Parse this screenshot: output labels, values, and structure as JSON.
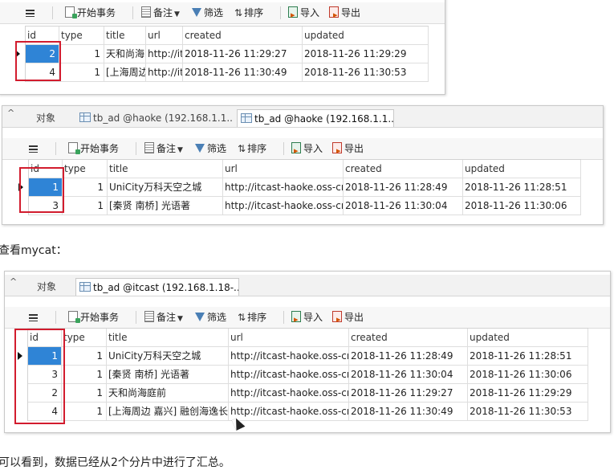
{
  "toolbar": {
    "start_transaction": "开始事务",
    "memo": "备注",
    "filter": "筛选",
    "sort": "排序",
    "import": "导入",
    "export": "导出"
  },
  "columns": [
    "id",
    "type",
    "title",
    "url",
    "created",
    "updated"
  ],
  "panel1": {
    "rows": [
      {
        "id": "2",
        "type": "1",
        "title": "天和尚海",
        "url": "http://it",
        "created": "2018-11-26 11:29:27",
        "updated": "2018-11-26 11:29:29"
      },
      {
        "id": "4",
        "type": "1",
        "title": "[上海周边",
        "url": "http://it",
        "created": "2018-11-26 11:30:49",
        "updated": "2018-11-26 11:30:53"
      }
    ]
  },
  "panel2": {
    "tab_objects": "对象",
    "tab_1": "tb_ad @haoke (192.168.1.1...",
    "tab_2": "tb_ad @haoke (192.168.1.1...",
    "rows": [
      {
        "id": "1",
        "type": "1",
        "title": "UniCity万科天空之城",
        "url": "http://itcast-haoke.oss-cn",
        "created": "2018-11-26 11:28:49",
        "updated": "2018-11-26 11:28:51"
      },
      {
        "id": "3",
        "type": "1",
        "title": "[秦贤 南桥] 光语著",
        "url": "http://itcast-haoke.oss-cn",
        "created": "2018-11-26 11:30:04",
        "updated": "2018-11-26 11:30:06"
      }
    ]
  },
  "mid_text": "查看mycat：",
  "panel3": {
    "tab_objects": "对象",
    "tab_1": "tb_ad @itcast (192.168.1.18-...",
    "rows": [
      {
        "id": "1",
        "type": "1",
        "title": "UniCity万科天空之城",
        "url": "http://itcast-haoke.oss-cn",
        "created": "2018-11-26 11:28:49",
        "updated": "2018-11-26 11:28:51"
      },
      {
        "id": "3",
        "type": "1",
        "title": "[秦贤 南桥] 光语著",
        "url": "http://itcast-haoke.oss-cn",
        "created": "2018-11-26 11:30:04",
        "updated": "2018-11-26 11:30:06"
      },
      {
        "id": "2",
        "type": "1",
        "title": "天和尚海庭前",
        "url": "http://itcast-haoke.oss-cn",
        "created": "2018-11-26 11:29:27",
        "updated": "2018-11-26 11:29:29"
      },
      {
        "id": "4",
        "type": "1",
        "title": "[上海周边 嘉兴] 融创海逸长",
        "url": "http://itcast-haoke.oss-cn",
        "created": "2018-11-26 11:30:49",
        "updated": "2018-11-26 11:30:53"
      }
    ]
  },
  "bottom_text": "可以看到，数据已经从2个分片中进行了汇总。",
  "colors": {
    "selection": "#2f84d6",
    "highlight_box": "#d21c2e"
  }
}
